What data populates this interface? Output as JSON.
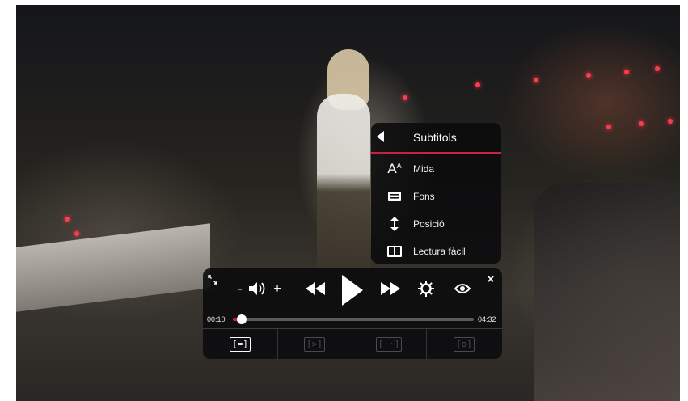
{
  "subtitles_menu": {
    "title": "Subtitols",
    "back_icon": "back-triangle-icon",
    "items": [
      {
        "label": "Mida",
        "icon": "text-size-icon",
        "glyph": "A"
      },
      {
        "label": "Fons",
        "icon": "background-box-icon",
        "glyph": "☰"
      },
      {
        "label": "Posició",
        "icon": "vertical-position-icon",
        "glyph": "↕"
      },
      {
        "label": "Lectura fàcil",
        "icon": "book-icon",
        "glyph": "📖"
      }
    ],
    "accent_color": "#c4243d"
  },
  "player": {
    "expand_icon": "fullscreen-icon",
    "volume_down": "-",
    "volume_up": "+",
    "close": "×",
    "current_time": "00:10",
    "total_time": "04:32",
    "progress_fraction": 0.037,
    "progress_color": "#c4243d",
    "modes": [
      {
        "glyph": "[=]",
        "name": "subtitles-mode-icon",
        "active": true
      },
      {
        "glyph": "[>]",
        "name": "audio-description-mode-icon",
        "active": false
      },
      {
        "glyph": "[··]",
        "name": "sign-language-mode-icon",
        "active": false
      },
      {
        "glyph": "[o]",
        "name": "audio-subtitles-mode-icon",
        "active": false
      }
    ]
  }
}
